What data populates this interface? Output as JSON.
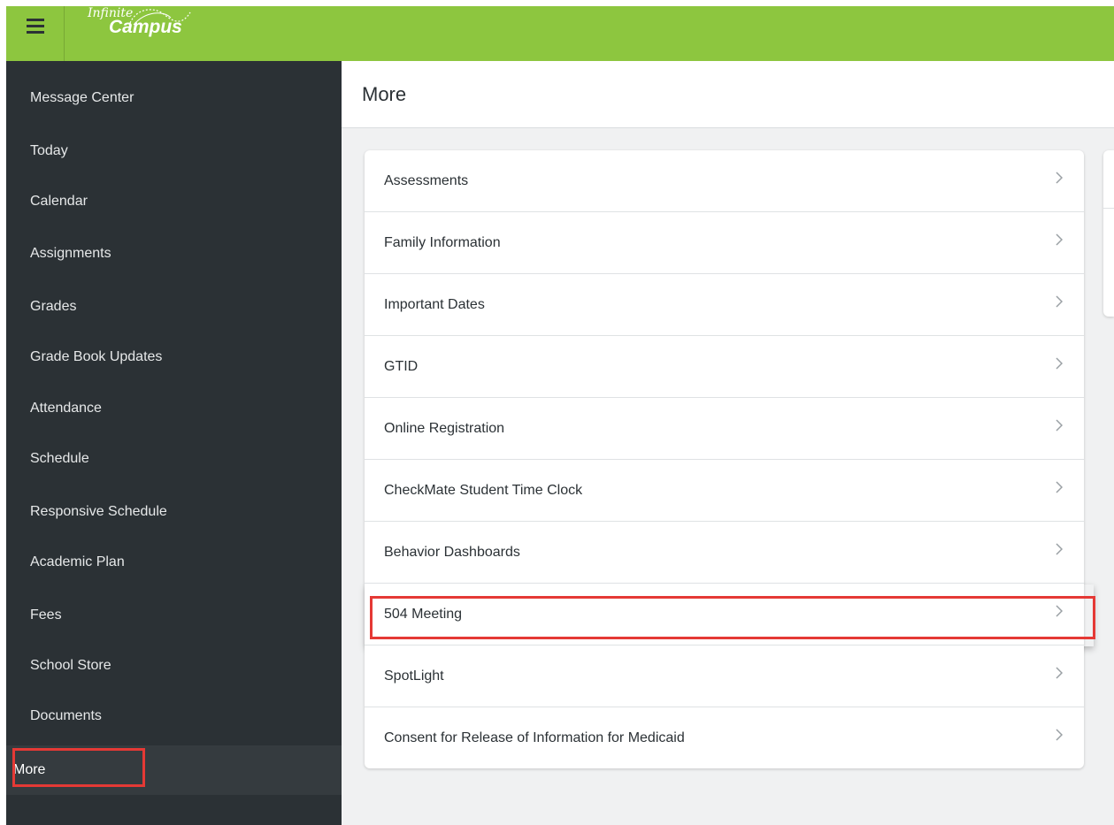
{
  "header": {
    "logo_line1": "Infinite",
    "logo_line2": "Campus",
    "menu_icon": "hamburger-menu-icon"
  },
  "sidebar": {
    "items": [
      {
        "label": "Message Center"
      },
      {
        "label": "Today"
      },
      {
        "label": "Calendar"
      },
      {
        "label": "Assignments"
      },
      {
        "label": "Grades"
      },
      {
        "label": "Grade Book Updates"
      },
      {
        "label": "Attendance"
      },
      {
        "label": "Schedule"
      },
      {
        "label": "Responsive Schedule"
      },
      {
        "label": "Academic Plan"
      },
      {
        "label": "Fees"
      },
      {
        "label": "School Store"
      },
      {
        "label": "Documents"
      },
      {
        "label": "More"
      }
    ],
    "active": "More"
  },
  "main": {
    "title": "More",
    "list": [
      {
        "label": "Assessments"
      },
      {
        "label": "Family Information"
      },
      {
        "label": "Important Dates"
      },
      {
        "label": "GTID"
      },
      {
        "label": "Online Registration"
      },
      {
        "label": "CheckMate Student Time Clock"
      },
      {
        "label": "Behavior Dashboards"
      },
      {
        "label": "504 Meeting"
      },
      {
        "label": "SpotLight"
      },
      {
        "label": "Consent for Release of Information for Medicaid"
      }
    ],
    "chevron_icon": "chevron-right-icon"
  },
  "colors": {
    "brand_green": "#8dc63f",
    "sidebar_bg": "#2b3135",
    "highlight_red": "#e53935"
  }
}
